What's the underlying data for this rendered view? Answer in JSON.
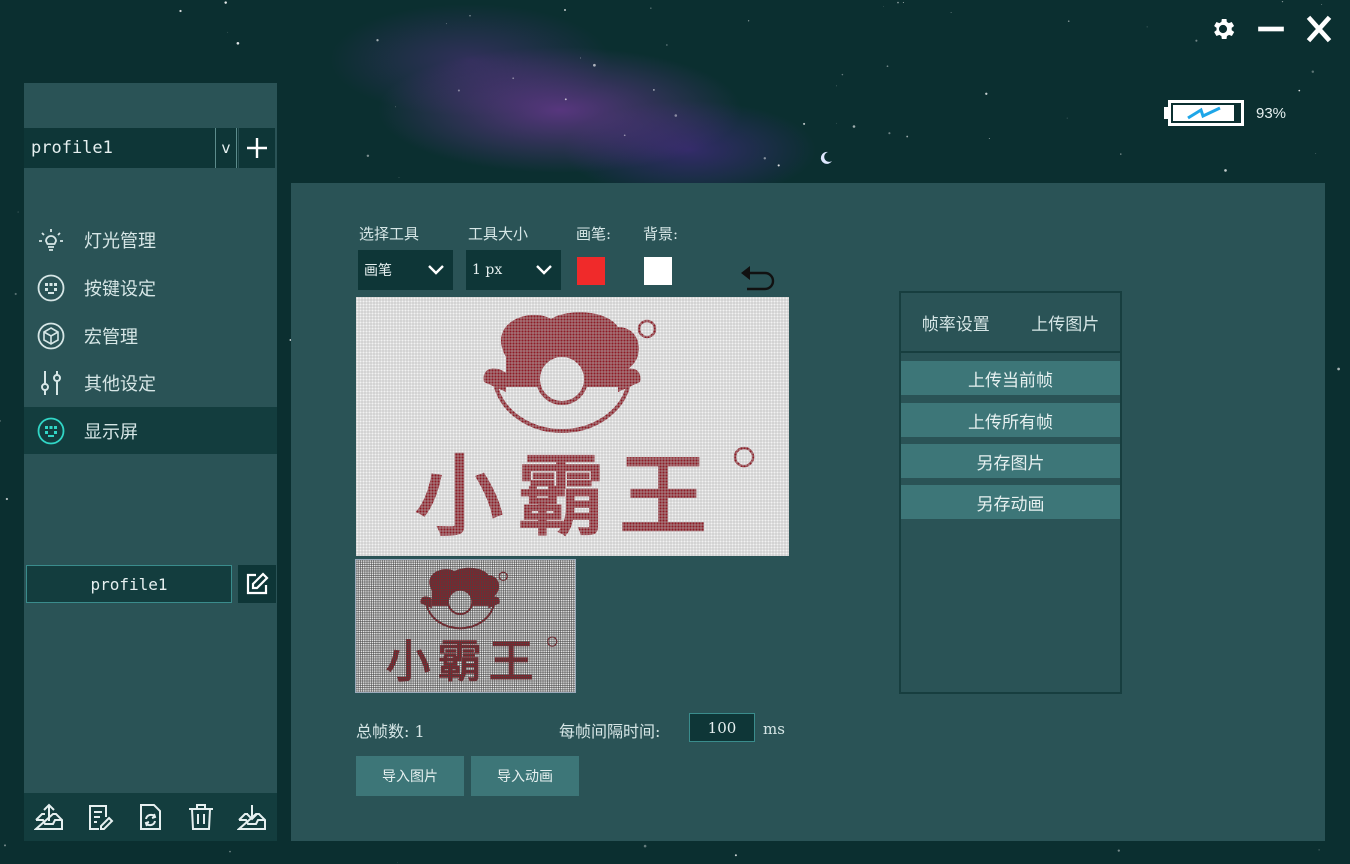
{
  "window": {
    "controls": [
      "gear-icon",
      "minimize-icon",
      "close-icon"
    ],
    "battery": {
      "percent_label": "93%",
      "level": 0.93,
      "icon": "lightning-icon"
    }
  },
  "sidebar": {
    "profile_select": {
      "value": "profile1",
      "caret": "v"
    },
    "nav": [
      {
        "label": "灯光管理",
        "icon": "bulb-icon"
      },
      {
        "label": "按键设定",
        "icon": "keyboard-icon"
      },
      {
        "label": "宏管理",
        "icon": "cube-icon"
      },
      {
        "label": "其他设定",
        "icon": "sliders-icon"
      },
      {
        "label": "显示屏",
        "icon": "display-icon",
        "active": true
      }
    ],
    "profile_name": "profile1",
    "bottom_icons": [
      "export-icon",
      "notes-icon",
      "refresh-file-icon",
      "trash-icon",
      "import-icon"
    ]
  },
  "editor": {
    "tool_label": "选择工具",
    "tool_value": "画笔",
    "size_label": "工具大小",
    "size_value": "1 px",
    "brush_label": "画笔:",
    "bg_label": "背景:",
    "colors": {
      "brush": "#f02a2a",
      "background": "#ffffff",
      "ink": "#8e1c26",
      "accent": "#3d7678"
    },
    "logo_text": "小霸王",
    "frames_label": "总帧数: 1",
    "interval_label": "每帧间隔时间:",
    "interval_value": "100",
    "interval_unit": "ms",
    "import_image": "导入图片",
    "import_anim": "导入动画"
  },
  "right_panel": {
    "tabs": [
      "帧率设置",
      "上传图片"
    ],
    "buttons": [
      "上传当前帧",
      "上传所有帧",
      "另存图片",
      "另存动画"
    ]
  }
}
